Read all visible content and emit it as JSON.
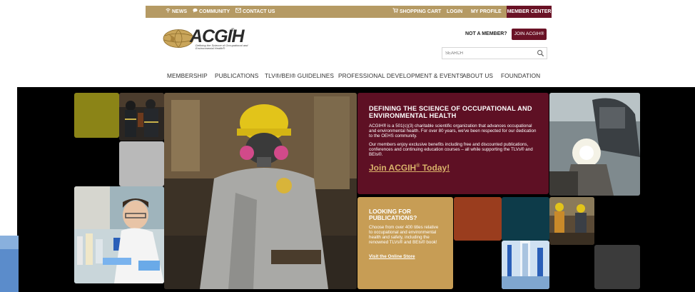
{
  "topbar": {
    "news": "NEWS",
    "community": "COMMUNITY",
    "contact": "CONTACT US",
    "cart": "SHOPPING CART",
    "login": "LOGIN",
    "profile": "MY PROFILE",
    "member_center": "MEMBER CENTER"
  },
  "header": {
    "logo_text": "ACGIH",
    "logo_reg": "®",
    "tagline": "Defining the Science of Occupational and Environmental Health®",
    "not_member": "NOT A MEMBER?",
    "join_button": "JOIN ACGIH®",
    "search_placeholder": "SEARCH"
  },
  "nav": {
    "items": [
      "MEMBERSHIP",
      "PUBLICATIONS",
      "TLV®/BEI® GUIDELINES",
      "PROFESSIONAL DEVELOPMENT & EVENTS",
      "ABOUT US",
      "FOUNDATION"
    ]
  },
  "promo": {
    "heading": "DEFINING THE SCIENCE OF OCCUPATIONAL AND ENVIRONMENTAL HEALTH",
    "para1": "ACGIH® is a 501(c)(3) charitable scientific organization that advances occupational and environmental health. For over 80 years, we've been respected for our dedication to the OEHS community.",
    "para2": "Our members enjoy exclusive benefits including free and discounted publications, conferences and continuing education courses – all while supporting the TLVs® and BEIs®.",
    "join_link": "Join ACGIH",
    "join_reg": "®",
    "join_tail": " Today!"
  },
  "publications": {
    "heading": "LOOKING FOR PUBLICATIONS?",
    "body": "Choose from over 400 titles relative to occupational and environmental health and safety, including the renowned TLVs® and BEIs® book!",
    "link": "Visit the Online Store"
  },
  "colors": {
    "gold": "#b59a64",
    "maroon": "#5e1024",
    "tan": "#c79d55",
    "olive": "#8b8417",
    "rust": "#9a3d1e",
    "teal": "#0d3b49",
    "gray_tile": "#b9b9b9",
    "dark_gray_tile": "#3b3b3b"
  },
  "icons": {
    "news": "wifi-icon",
    "community": "chat-icon",
    "contact": "envelope-icon",
    "cart": "cart-icon",
    "search": "search-icon"
  }
}
